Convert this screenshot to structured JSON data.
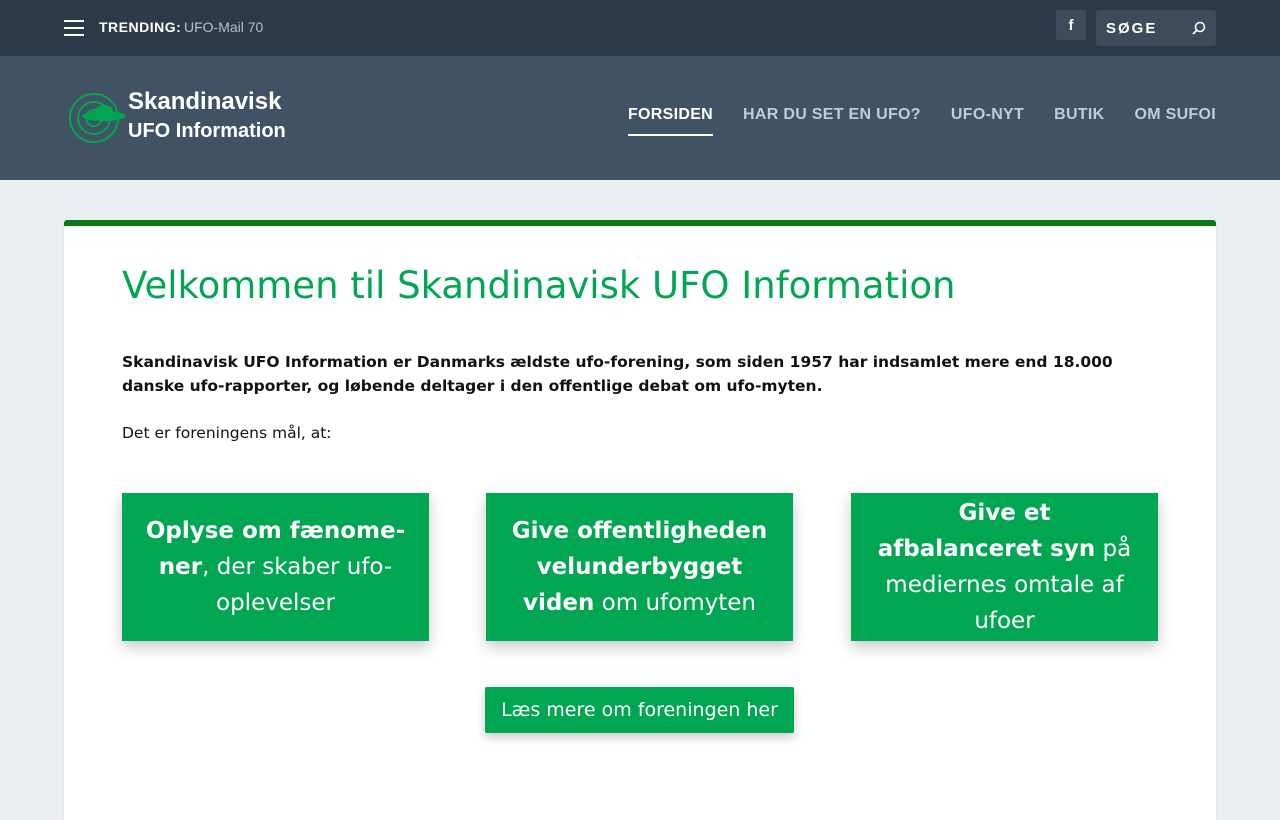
{
  "topbar": {
    "trending_label": "TRENDING:",
    "trending_link": "UFO-Mail 70",
    "facebook_label": "f",
    "search_placeholder": "SØGE"
  },
  "header": {
    "logo_line1": "Skandinavisk",
    "logo_line2": "UFO Information",
    "nav": [
      {
        "label": "FORSIDEN",
        "active": true
      },
      {
        "label": "HAR DU SET EN UFO?",
        "active": false
      },
      {
        "label": "UFO-NYT",
        "active": false
      },
      {
        "label": "BUTIK",
        "active": false
      },
      {
        "label": "OM SUFOI",
        "active": false
      }
    ]
  },
  "main": {
    "title": "Velkommen til Skandinavisk UFO Information",
    "intro": "Skandinavisk UFO Information er Danmarks ældste ufo-forening, som siden 1957 har indsamlet mere end 18.000 danske ufo-rap­porter, og løbende deltager i den offentlige debat om ufo-myten.",
    "goal_intro": "Det er foreningens mål, at:",
    "goals": [
      {
        "bold": "Oplyse om fænome­ner",
        "rest": ", der skaber ufo-oplevelser"
      },
      {
        "bold": "Give offentligheden velunderbygget viden",
        "rest": " om ufomyten"
      },
      {
        "bold": "Give et afbalanceret syn",
        "rest": " på mediernes omtale af ufoer"
      }
    ],
    "more_button": "Læs mere om foreningen her"
  },
  "colors": {
    "topbar": "#2c3a49",
    "header": "#415264",
    "accent_green": "#00a651",
    "card_border": "#0a7a12",
    "background": "#ebeff4"
  }
}
